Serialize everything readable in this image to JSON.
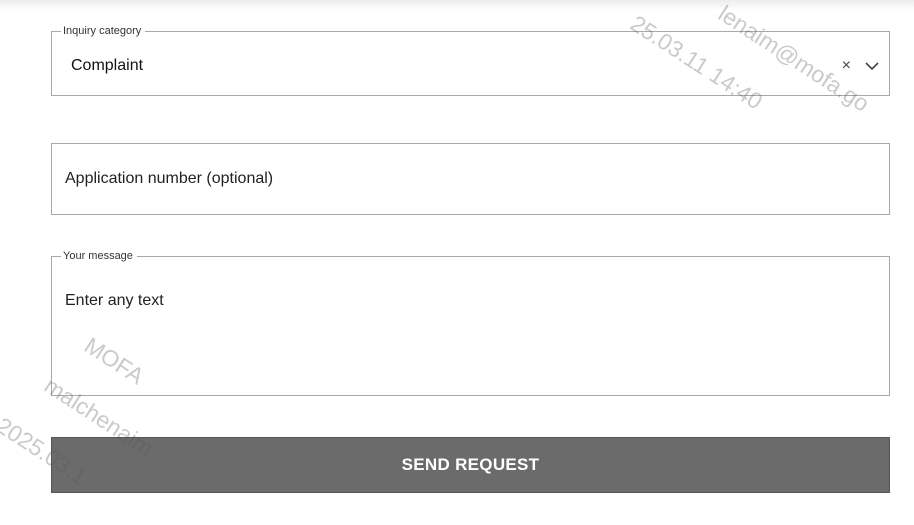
{
  "form": {
    "category": {
      "legend": "Inquiry category",
      "value": "Complaint",
      "clear_symbol": "×"
    },
    "application_number": {
      "placeholder": "Application number (optional)"
    },
    "message": {
      "legend": "Your message",
      "placeholder": "Enter any text"
    },
    "submit_label": "SEND REQUEST"
  },
  "watermark": {
    "org": "MOFA",
    "user_fragment_top": "lenaim@mofa.go",
    "user_fragment_bottom": "malchenaim",
    "date_fragment_top": "25.03.11 14:40",
    "date_fragment_bottom": "2025.03.1"
  },
  "colors": {
    "button_bg": "#6b6b6b",
    "border": "#a8a8a8",
    "watermark": "#5a5a5a"
  }
}
